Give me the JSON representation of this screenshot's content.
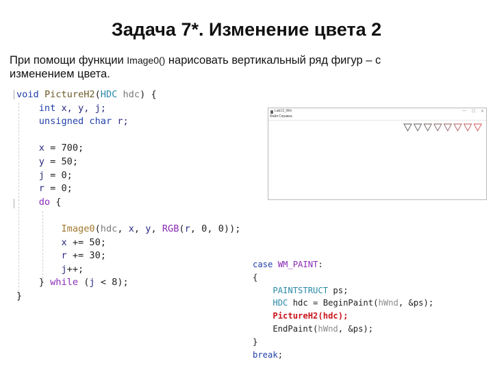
{
  "slide": {
    "title": "Задача 7*. Изменение цвета 2",
    "description_part1": "При помощи функции ",
    "description_func": "Image0()",
    "description_part2": " нарисовать вертикальный ряд фигур – с изменением цвета."
  },
  "code_main": {
    "lines": [
      [
        {
          "t": "void",
          "c": "kw"
        },
        {
          "t": " "
        },
        {
          "t": "PictureH2",
          "c": "fn"
        },
        {
          "t": "("
        },
        {
          "t": "HDC",
          "c": "type"
        },
        {
          "t": " "
        },
        {
          "t": "hdc",
          "c": "param"
        },
        {
          "t": ") {"
        }
      ],
      [
        {
          "t": "    "
        },
        {
          "t": "int",
          "c": "kw"
        },
        {
          "t": " "
        },
        {
          "t": "x, y, j;",
          "c": "var"
        }
      ],
      [
        {
          "t": "    "
        },
        {
          "t": "unsigned",
          "c": "kw"
        },
        {
          "t": " "
        },
        {
          "t": "char",
          "c": "kw"
        },
        {
          "t": " "
        },
        {
          "t": "r;",
          "c": "var"
        }
      ],
      [
        {
          "t": ""
        }
      ],
      [
        {
          "t": "    "
        },
        {
          "t": "x",
          "c": "var"
        },
        {
          "t": " = 700;"
        }
      ],
      [
        {
          "t": "    "
        },
        {
          "t": "y",
          "c": "var"
        },
        {
          "t": " = 50;"
        }
      ],
      [
        {
          "t": "    "
        },
        {
          "t": "j",
          "c": "var"
        },
        {
          "t": " = 0;"
        }
      ],
      [
        {
          "t": "    "
        },
        {
          "t": "r",
          "c": "var"
        },
        {
          "t": " = 0;"
        }
      ],
      [
        {
          "t": "    "
        },
        {
          "t": "do",
          "c": "kw2"
        },
        {
          "t": " {"
        }
      ],
      [
        {
          "t": ""
        }
      ],
      [
        {
          "t": "        "
        },
        {
          "t": "Image0",
          "c": "fn-img"
        },
        {
          "t": "("
        },
        {
          "t": "hdc",
          "c": "param"
        },
        {
          "t": ", "
        },
        {
          "t": "x",
          "c": "var"
        },
        {
          "t": ", "
        },
        {
          "t": "y",
          "c": "var"
        },
        {
          "t": ", "
        },
        {
          "t": "RGB",
          "c": "macro"
        },
        {
          "t": "("
        },
        {
          "t": "r",
          "c": "var"
        },
        {
          "t": ", 0, 0));"
        }
      ],
      [
        {
          "t": "        "
        },
        {
          "t": "x",
          "c": "var"
        },
        {
          "t": " += 50;"
        }
      ],
      [
        {
          "t": "        "
        },
        {
          "t": "r",
          "c": "var"
        },
        {
          "t": " += 30;"
        }
      ],
      [
        {
          "t": "        "
        },
        {
          "t": "j",
          "c": "var"
        },
        {
          "t": "++;"
        }
      ],
      [
        {
          "t": "    } "
        },
        {
          "t": "while",
          "c": "kw2"
        },
        {
          "t": " ("
        },
        {
          "t": "j",
          "c": "var"
        },
        {
          "t": " < 8);"
        }
      ],
      [
        {
          "t": "}"
        }
      ]
    ]
  },
  "code_paint": {
    "lines": [
      [
        {
          "t": "case",
          "c": "c2-kw"
        },
        {
          "t": " "
        },
        {
          "t": "WM_PAINT",
          "c": "c2-macro"
        },
        {
          "t": ":"
        }
      ],
      [
        {
          "t": "{"
        }
      ],
      [
        {
          "t": "    "
        },
        {
          "t": "PAINTSTRUCT",
          "c": "c2-type"
        },
        {
          "t": " ps;"
        }
      ],
      [
        {
          "t": "    "
        },
        {
          "t": "HDC",
          "c": "c2-type"
        },
        {
          "t": " hdc = BeginPaint("
        },
        {
          "t": "hWnd",
          "c": "c2-param"
        },
        {
          "t": ", &ps);"
        }
      ],
      [
        {
          "t": "    "
        },
        {
          "t": "PictureH2(hdc);",
          "c": "red"
        }
      ],
      [
        {
          "t": "    EndPaint("
        },
        {
          "t": "hWnd",
          "c": "c2-param"
        },
        {
          "t": ", &ps);"
        }
      ],
      [
        {
          "t": "}"
        }
      ],
      [
        {
          "t": "break",
          "c": "c2-kw"
        },
        {
          "t": ";"
        }
      ]
    ]
  },
  "app_window": {
    "title": "Lab13_Win",
    "menu": [
      "Файл",
      "Справка"
    ],
    "controls": {
      "minimize": "—",
      "maximize": "☐",
      "close": "✕"
    },
    "triangles": {
      "count": 8,
      "red_values": [
        0,
        30,
        60,
        90,
        120,
        150,
        180,
        210
      ],
      "colors": [
        "#555555",
        "#5e5757",
        "#6a5a5a",
        "#7a5c5c",
        "#8e5a5a",
        "#a85656",
        "#c05555",
        "#d05050"
      ]
    }
  }
}
